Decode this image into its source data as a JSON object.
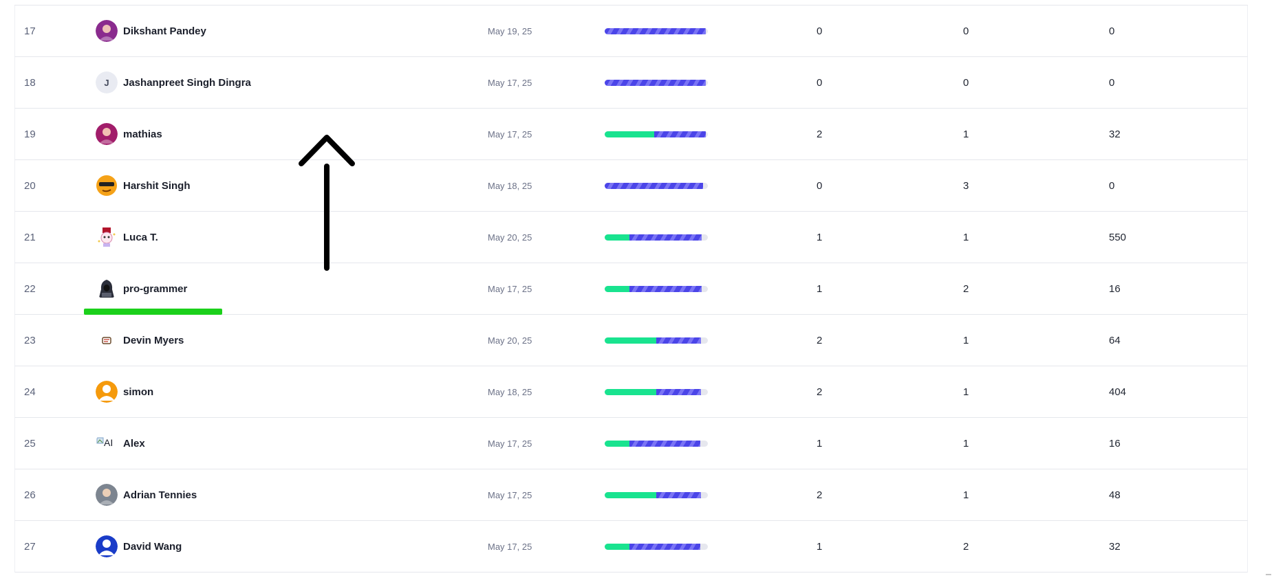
{
  "rows": [
    {
      "rank": "17",
      "name": "Dikshant Pandey",
      "date": "May 19, 25",
      "progress": {
        "green": 0,
        "blue": 0.98
      },
      "c1": "0",
      "c2": "0",
      "c3": "0",
      "avatar": "photo-avatar",
      "avatar_color": "#8a2b8e"
    },
    {
      "rank": "18",
      "name": "Jashanpreet Singh Dingra",
      "date": "May 17, 25",
      "progress": {
        "green": 0,
        "blue": 0.98
      },
      "c1": "0",
      "c2": "0",
      "c3": "0",
      "avatar": "letter-avatar",
      "avatar_letter": "J",
      "avatar_color": "#e9ebf2"
    },
    {
      "rank": "19",
      "name": "mathias",
      "date": "May 17, 25",
      "progress": {
        "green": 0.48,
        "blue": 0.5
      },
      "c1": "2",
      "c2": "1",
      "c3": "32",
      "avatar": "photo-avatar",
      "avatar_color": "#a11d6a"
    },
    {
      "rank": "20",
      "name": "Harshit Singh",
      "date": "May 18, 25",
      "progress": {
        "green": 0,
        "blue": 0.95
      },
      "c1": "0",
      "c2": "3",
      "c3": "0",
      "avatar": "emoji-sunglasses-avatar",
      "avatar_color": "#f5a218"
    },
    {
      "rank": "21",
      "name": "Luca T.",
      "date": "May 20, 25",
      "progress": {
        "green": 0.24,
        "blue": 0.7
      },
      "c1": "1",
      "c2": "1",
      "c3": "550",
      "avatar": "cartoon-avatar",
      "avatar_color": "#ffffff"
    },
    {
      "rank": "22",
      "name": "pro-grammer",
      "date": "May 17, 25",
      "progress": {
        "green": 0.24,
        "blue": 0.7
      },
      "c1": "1",
      "c2": "2",
      "c3": "16",
      "avatar": "hooded-figure-avatar",
      "avatar_color": "#ffffff"
    },
    {
      "rank": "23",
      "name": "Devin Myers",
      "date": "May 20, 25",
      "progress": {
        "green": 0.5,
        "blue": 0.43
      },
      "c1": "2",
      "c2": "1",
      "c3": "64",
      "avatar": "small-logo-avatar",
      "avatar_color": "#ffffff"
    },
    {
      "rank": "24",
      "name": "simon",
      "date": "May 18, 25",
      "progress": {
        "green": 0.5,
        "blue": 0.43
      },
      "c1": "2",
      "c2": "1",
      "c3": "404",
      "avatar": "person-silhouette-avatar",
      "avatar_color": "#f59a0c"
    },
    {
      "rank": "25",
      "name": "Alex",
      "date": "May 17, 25",
      "progress": {
        "green": 0.24,
        "blue": 0.69
      },
      "c1": "1",
      "c2": "1",
      "c3": "16",
      "avatar": "broken-image-avatar",
      "avatar_alt": "AI",
      "avatar_color": "#ffffff"
    },
    {
      "rank": "26",
      "name": "Adrian Tennies",
      "date": "May 17, 25",
      "progress": {
        "green": 0.5,
        "blue": 0.43
      },
      "c1": "2",
      "c2": "1",
      "c3": "48",
      "avatar": "photo-avatar",
      "avatar_color": "#7d8590"
    },
    {
      "rank": "27",
      "name": "David Wang",
      "date": "May 17, 25",
      "progress": {
        "green": 0.24,
        "blue": 0.69
      },
      "c1": "1",
      "c2": "2",
      "c3": "32",
      "avatar": "person-silhouette-avatar",
      "avatar_color": "#1a3cc8"
    }
  ],
  "colors": {
    "green": "#19e38f",
    "blue": "#4b45e8",
    "annotation_arrow": "#000000",
    "annotation_underline": "#1bd01b"
  }
}
